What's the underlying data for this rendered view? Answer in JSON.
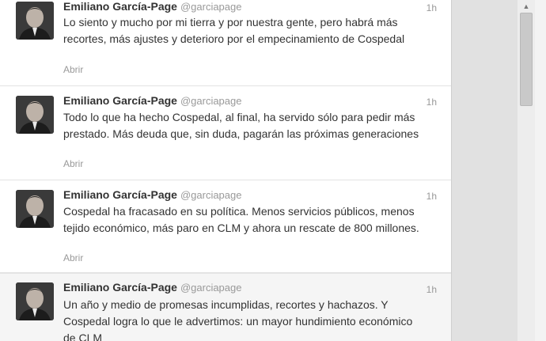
{
  "tweets": [
    {
      "name": "Emiliano García-Page",
      "handle": "@garciapage",
      "time": "1h",
      "text": "Lo siento y mucho por mi tierra y por nuestra gente, pero habrá más recortes, más ajustes y deterioro por el empecinamiento de Cospedal",
      "action": "Abrir"
    },
    {
      "name": "Emiliano García-Page",
      "handle": "@garciapage",
      "time": "1h",
      "text": "Todo lo que ha hecho Cospedal, al final, ha servido sólo para pedir más prestado. Más deuda que, sin duda, pagarán las próximas generaciones",
      "action": "Abrir"
    },
    {
      "name": "Emiliano García-Page",
      "handle": "@garciapage",
      "time": "1h",
      "text": "Cospedal ha fracasado en su política. Menos servicios públicos, menos tejido económico, más paro en CLM y ahora un rescate de 800 millones.",
      "action": "Abrir"
    },
    {
      "name": "Emiliano García-Page",
      "handle": "@garciapage",
      "time": "1h",
      "text": "Un año y medio de promesas incumplidas, recortes y hachazos. Y Cospedal logra lo que le advertimos: un mayor hundimiento económico de CLM",
      "action": ""
    }
  ],
  "scrollbar": {
    "up_arrow": "▲"
  }
}
